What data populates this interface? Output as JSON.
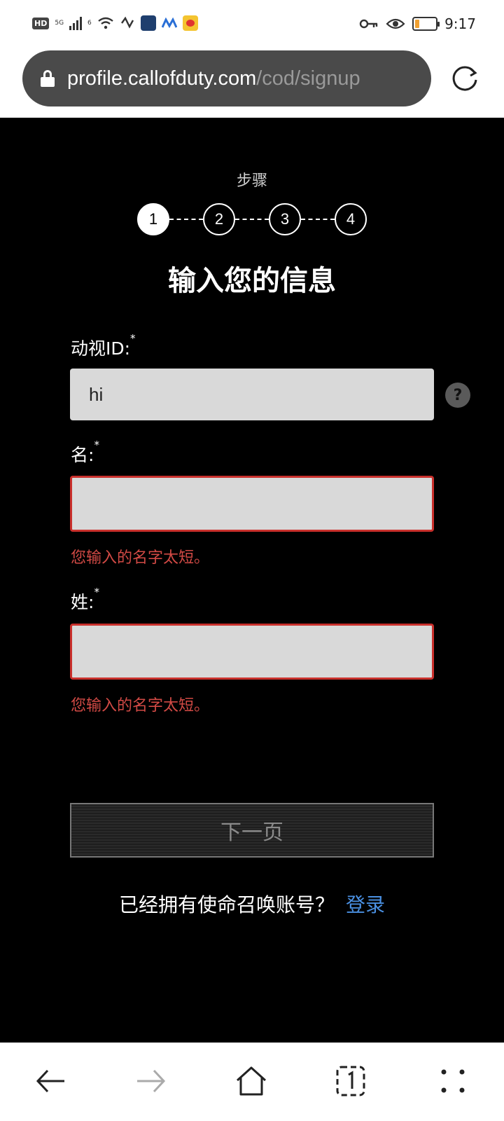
{
  "status_bar": {
    "hd_label": "HD",
    "network_label": "5G",
    "wifi_label": "6",
    "time": "9:17"
  },
  "browser": {
    "url_host": "profile.callofduty.com",
    "url_path": "/cod/signup"
  },
  "page": {
    "steps_label": "步骤",
    "steps": [
      "1",
      "2",
      "3",
      "4"
    ],
    "active_step": 1,
    "title": "输入您的信息",
    "activision_id": {
      "label": "动视ID:",
      "required_mark": "*",
      "value": "hi"
    },
    "first_name": {
      "label": "名:",
      "required_mark": "*",
      "value": "",
      "error": "您输入的名字太短。"
    },
    "last_name": {
      "label": "姓:",
      "required_mark": "*",
      "value": "",
      "error": "您输入的名字太短。"
    },
    "help_glyph": "?",
    "next_button": "下一页",
    "login_prompt": "已经拥有使命召唤账号？",
    "login_link": "登录"
  },
  "colors": {
    "error": "#d24a45",
    "link": "#4a90e2",
    "battery": "#f0a030"
  },
  "battery_level": 0.2
}
